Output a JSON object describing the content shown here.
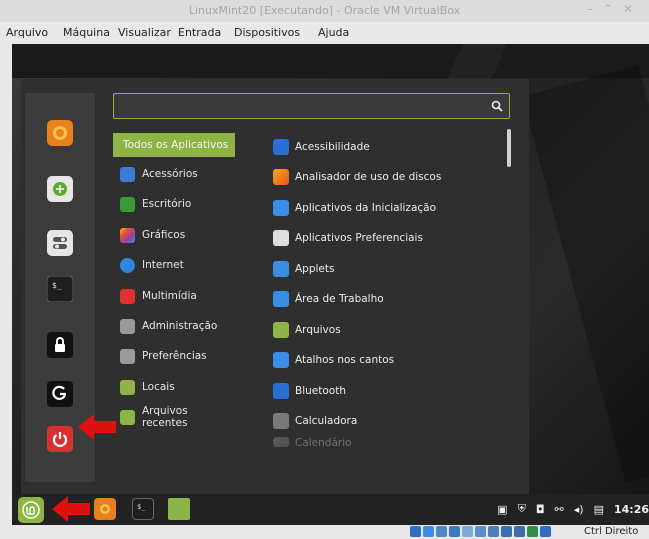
{
  "window": {
    "title": "LinuxMint20 [Executando] - Oracle VM VirtualBox"
  },
  "menubar": {
    "items": [
      "Arquivo",
      "Máquina",
      "Visualizar",
      "Entrada",
      "Dispositivos",
      "Ajuda"
    ]
  },
  "search": {
    "placeholder": ""
  },
  "categories": [
    {
      "label": "Todos os Aplicativos",
      "icon": "none",
      "active": true
    },
    {
      "label": "Acessórios",
      "icon": "accessories-icon",
      "color": "#3d7bd9"
    },
    {
      "label": "Escritório",
      "icon": "office-icon",
      "color": "#3a9a3a"
    },
    {
      "label": "Gráficos",
      "icon": "graphics-icon",
      "color": "#c0392b"
    },
    {
      "label": "Internet",
      "icon": "internet-icon",
      "color": "#2e86de"
    },
    {
      "label": "Multimídia",
      "icon": "multimedia-icon",
      "color": "#e03030"
    },
    {
      "label": "Administração",
      "icon": "administration-icon",
      "color": "#9a9a9a"
    },
    {
      "label": "Preferências",
      "icon": "preferences-icon",
      "color": "#9a9a9a"
    },
    {
      "label": "Locais",
      "icon": "places-folder-icon",
      "color": "#8db545"
    },
    {
      "label": "Arquivos recentes",
      "icon": "recent-folder-icon",
      "color": "#8db545"
    }
  ],
  "apps": [
    {
      "label": "Acessibilidade",
      "icon": "accessibility-icon",
      "color": "#2b6fd6"
    },
    {
      "label": "Analisador de uso de discos",
      "icon": "disk-usage-icon",
      "color": "#e8801e"
    },
    {
      "label": "Aplicativos da Inicialização",
      "icon": "startup-apps-icon",
      "color": "#3a8ee6"
    },
    {
      "label": "Aplicativos Preferenciais",
      "icon": "preferred-apps-icon",
      "color": "#dddddd"
    },
    {
      "label": "Applets",
      "icon": "applets-icon",
      "color": "#3a8ee6"
    },
    {
      "label": "Área de Trabalho",
      "icon": "desktop-icon",
      "color": "#3a8ee6"
    },
    {
      "label": "Arquivos",
      "icon": "files-icon",
      "color": "#8db545"
    },
    {
      "label": "Atalhos nos cantos",
      "icon": "hot-corners-icon",
      "color": "#3a8ee6"
    },
    {
      "label": "Bluetooth",
      "icon": "bluetooth-icon",
      "color": "#2b6fd6"
    },
    {
      "label": "Calculadora",
      "icon": "calculator-icon",
      "color": "#7a7a7a"
    },
    {
      "label": "Calendário",
      "icon": "calendar-icon",
      "color": "#555555",
      "faded": true
    }
  ],
  "favorites": [
    {
      "name": "firefox-icon",
      "color": "#e8801e"
    },
    {
      "name": "software-manager-icon",
      "color": "#e6e6e6"
    },
    {
      "name": "settings-icon",
      "color": "#e6e6e6"
    },
    {
      "name": "terminal-icon",
      "color": "#222222"
    },
    {
      "name": "lock-icon",
      "color": "#111111"
    },
    {
      "name": "logout-icon",
      "color": "#111111"
    },
    {
      "name": "power-icon",
      "color": "#d93030"
    }
  ],
  "taskbar": {
    "clock": "14:26",
    "menu_button_color": "#8db545"
  },
  "statusbar": {
    "host_key": "Ctrl Direito"
  },
  "colors": {
    "accent": "#8db545",
    "annotation_arrow": "#e01010"
  }
}
